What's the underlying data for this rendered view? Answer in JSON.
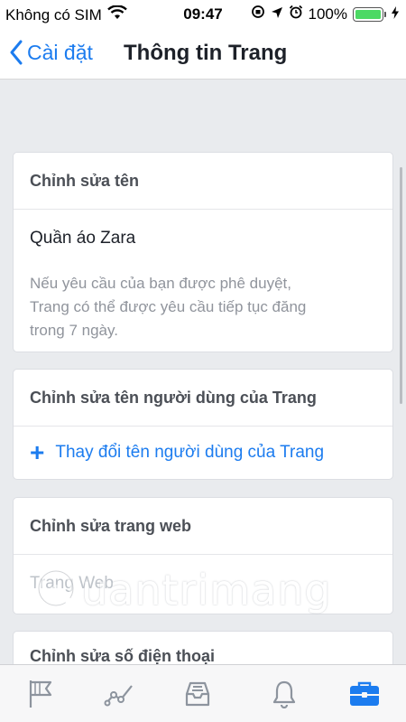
{
  "status_bar": {
    "carrier": "Không có SIM",
    "time": "09:47",
    "battery": "100%"
  },
  "nav": {
    "back_label": "Cài đặt",
    "title": "Thông tin Trang"
  },
  "sections": {
    "name": {
      "header": "Chỉnh sửa tên",
      "value": "Quần áo Zara",
      "hint_lines": [
        "Nếu yêu cầu của bạn được phê duyệt,",
        "Trang có thể được yêu cầu tiếp tục đăng",
        "trong 7 ngày."
      ]
    },
    "username": {
      "header": "Chỉnh sửa tên người dùng của Trang",
      "action": "Thay đổi tên người dùng của Trang"
    },
    "website": {
      "header": "Chỉnh sửa trang web",
      "placeholder": "Trang Web"
    },
    "phone": {
      "header": "Chỉnh sửa số điện thoại"
    }
  },
  "watermark": "uantrimang",
  "tab_bar": {
    "tabs": [
      "flag-icon",
      "insights-icon",
      "inbox-icon",
      "bell-icon",
      "briefcase-icon"
    ],
    "active_index": 4
  },
  "colors": {
    "accent": "#1c7cef",
    "background": "#e9ebee",
    "battery": "#4cd964"
  }
}
